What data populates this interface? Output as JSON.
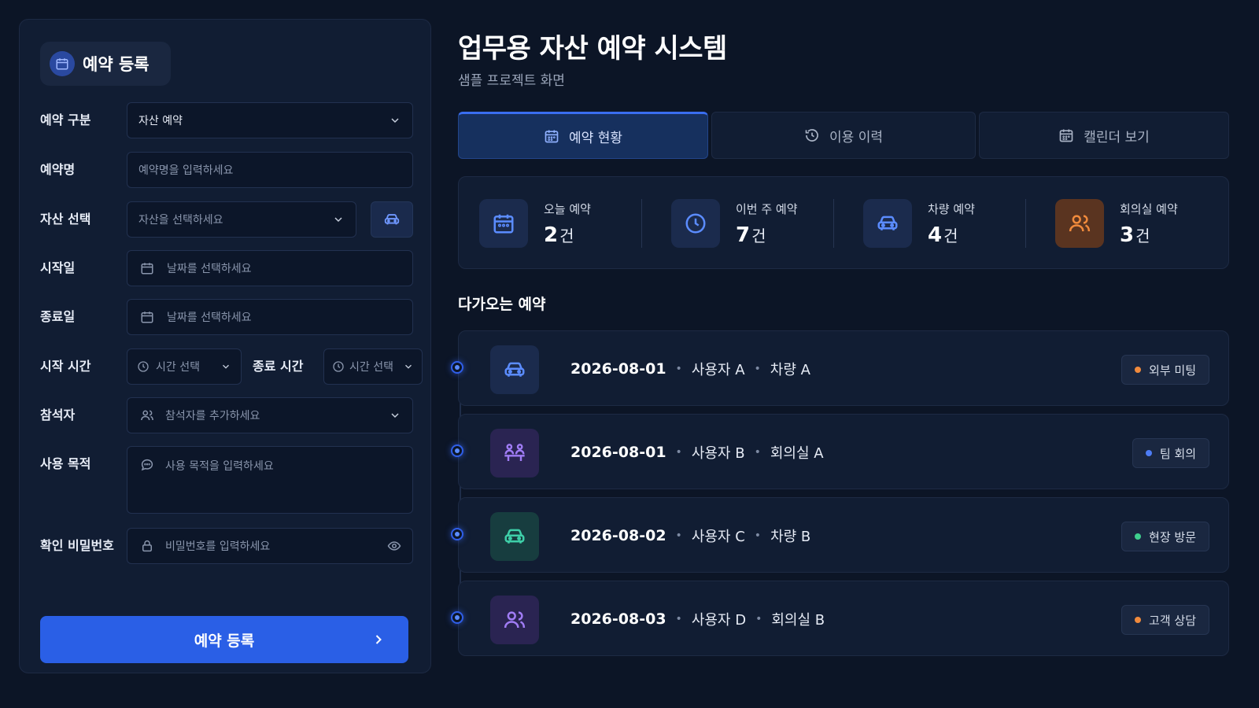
{
  "form": {
    "title": "예약 등록",
    "type_label": "예약 구분",
    "type_value": "자산 예약",
    "name_label": "예약명",
    "name_placeholder": "예약명을 입력하세요",
    "asset_label": "자산 선택",
    "asset_placeholder": "자산을 선택하세요",
    "start_date_label": "시작일",
    "start_date_placeholder": "날짜를 선택하세요",
    "end_date_label": "종료일",
    "end_date_placeholder": "날짜를 선택하세요",
    "start_time_label": "시작 시간",
    "start_time_placeholder": "시간 선택",
    "end_time_label": "종료 시간",
    "end_time_placeholder": "시간 선택",
    "attendees_label": "참석자",
    "attendees_placeholder": "참석자를 추가하세요",
    "purpose_label": "사용 목적",
    "purpose_placeholder": "사용 목적을 입력하세요",
    "password_label": "확인 비밀번호",
    "password_placeholder": "비밀번호를 입력하세요",
    "submit_label": "예약 등록"
  },
  "header": {
    "title": "업무용 자산 예약 시스템",
    "subtitle": "샘플 프로젝트 화면"
  },
  "tabs": [
    {
      "label": "예약 현황",
      "icon": "calendar-icon",
      "active": true
    },
    {
      "label": "이용 이력",
      "icon": "history-icon",
      "active": false
    },
    {
      "label": "캘린더 보기",
      "icon": "calendar-icon",
      "active": false
    }
  ],
  "stats": [
    {
      "label": "오늘 예약",
      "value": "2",
      "unit": "건",
      "icon": "calendar-icon",
      "color": "#4d7cf5"
    },
    {
      "label": "이번 주 예약",
      "value": "7",
      "unit": "건",
      "icon": "clock-icon",
      "color": "#4d7cf5"
    },
    {
      "label": "차량 예약",
      "value": "4",
      "unit": "건",
      "icon": "car-icon",
      "color": "#4d7cf5"
    },
    {
      "label": "회의실 예약",
      "value": "3",
      "unit": "건",
      "icon": "users-icon",
      "color": "#f08a3c"
    }
  ],
  "upcoming": {
    "title": "다가오는 예약",
    "items": [
      {
        "date": "2026-08-01",
        "user": "사용자 A",
        "asset": "차량 A",
        "tag": "외부 미팅",
        "tag_color": "#f08a3c",
        "icon": "car-icon",
        "icon_color": "#5b8cff",
        "icon_bg": "#1b2b4d"
      },
      {
        "date": "2026-08-01",
        "user": "사용자 B",
        "asset": "회의실 A",
        "tag": "팀 회의",
        "tag_color": "#4d7cf5",
        "icon": "meeting-icon",
        "icon_color": "#a07cf5",
        "icon_bg": "#2a2452"
      },
      {
        "date": "2026-08-02",
        "user": "사용자 C",
        "asset": "차량 B",
        "tag": "현장 방문",
        "tag_color": "#3ecf8e",
        "icon": "car-icon",
        "icon_color": "#3ecfa8",
        "icon_bg": "#173d3f"
      },
      {
        "date": "2026-08-03",
        "user": "사용자 D",
        "asset": "회의실 B",
        "tag": "고객 상담",
        "tag_color": "#f08a3c",
        "icon": "users-icon",
        "icon_color": "#a07cf5",
        "icon_bg": "#2a2452"
      }
    ]
  }
}
